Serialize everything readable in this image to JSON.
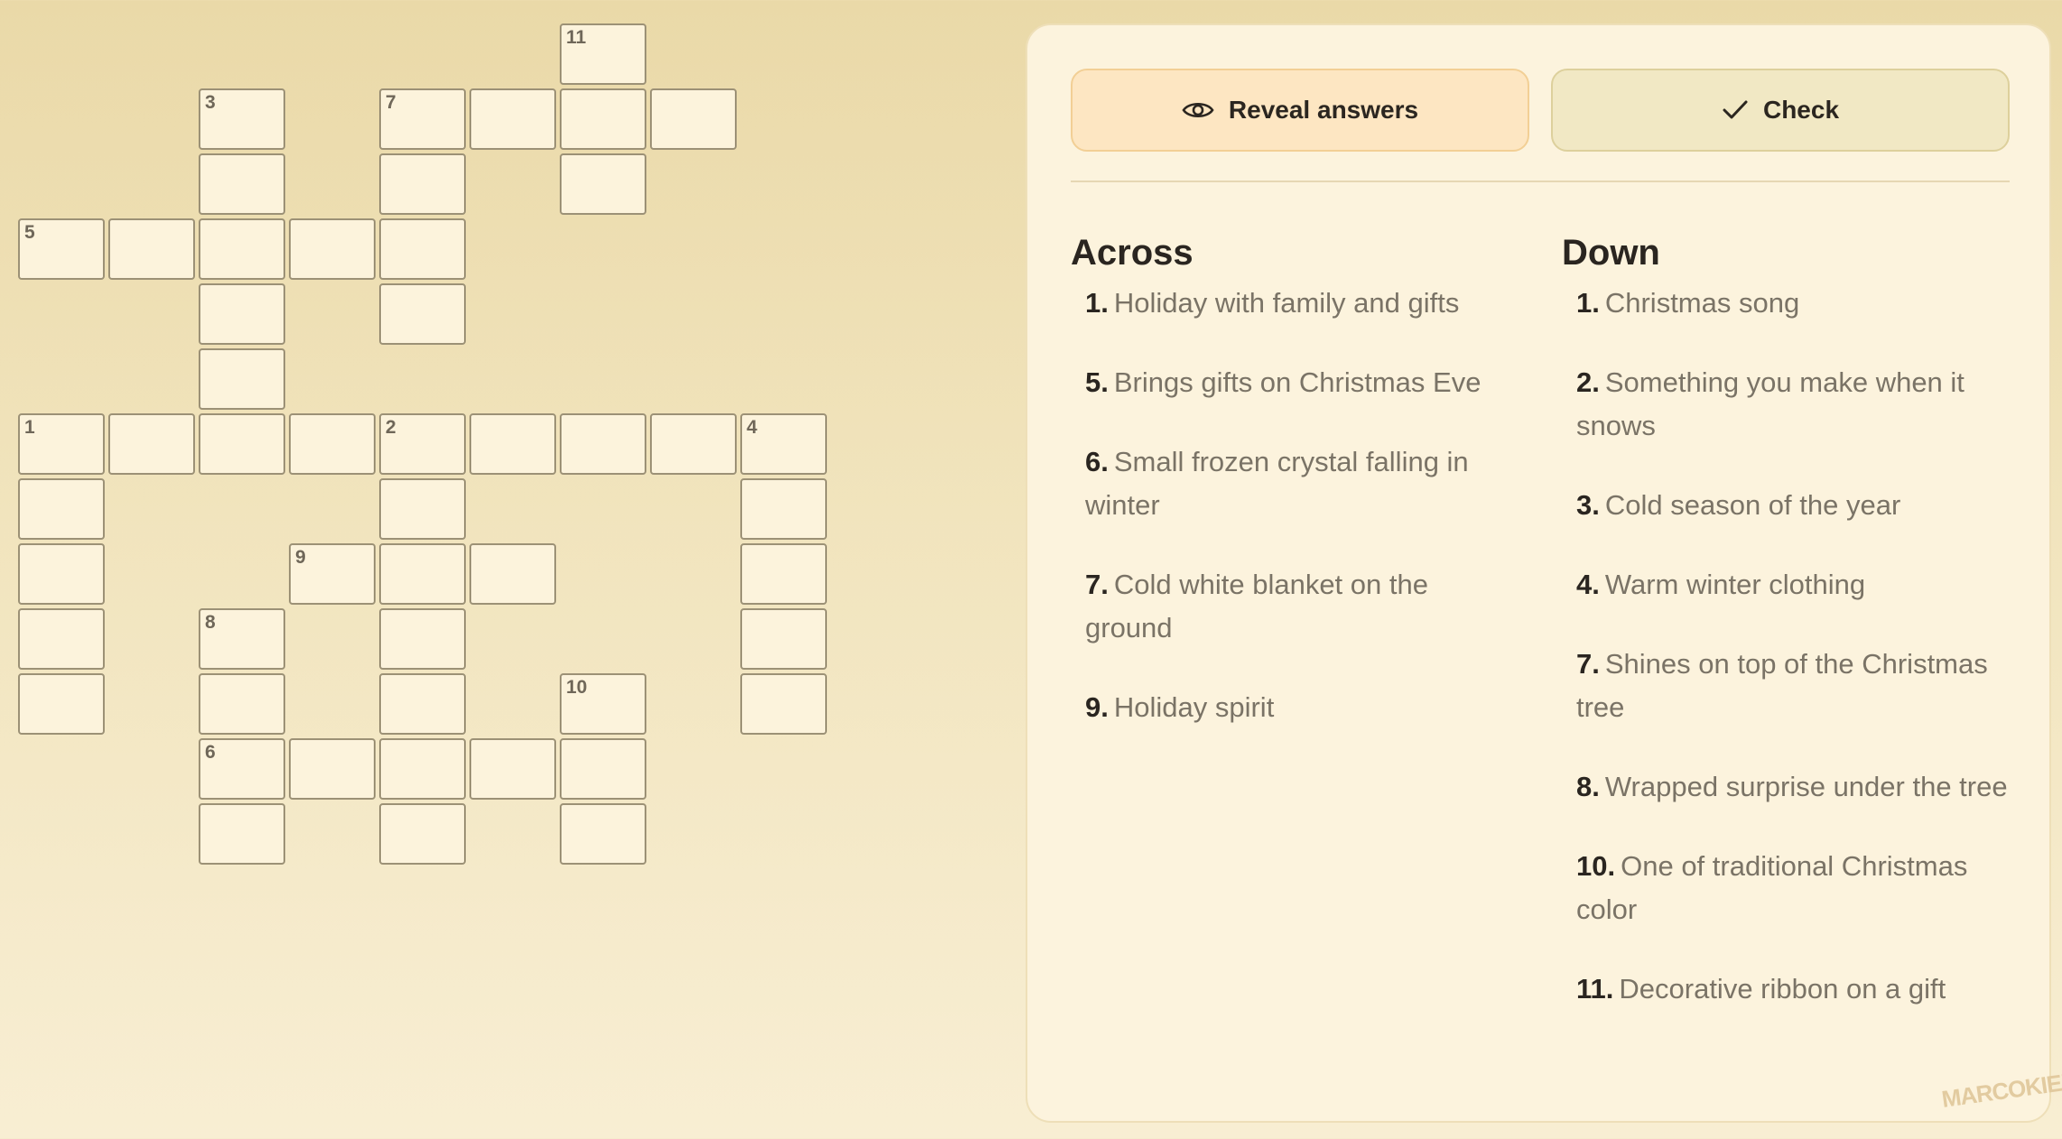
{
  "buttons": {
    "reveal_label": "Reveal answers",
    "check_label": "Check"
  },
  "clues": {
    "across_title": "Across",
    "down_title": "Down",
    "across": [
      {
        "num": "1.",
        "text": "Holiday with family and gifts"
      },
      {
        "num": "5.",
        "text": "Brings gifts on Christmas Eve"
      },
      {
        "num": "6.",
        "text": "Small frozen crystal falling in winter"
      },
      {
        "num": "7.",
        "text": "Cold white blanket on the ground"
      },
      {
        "num": "9.",
        "text": "Holiday spirit"
      }
    ],
    "down": [
      {
        "num": "1.",
        "text": "Christmas song"
      },
      {
        "num": "2.",
        "text": "Something you make when it snows"
      },
      {
        "num": "3.",
        "text": "Cold season of the year"
      },
      {
        "num": "4.",
        "text": "Warm winter clothing"
      },
      {
        "num": "7.",
        "text": "Shines on top of the Christmas tree"
      },
      {
        "num": "8.",
        "text": "Wrapped surprise under the tree"
      },
      {
        "num": "10.",
        "text": "One of traditional Christmas color"
      },
      {
        "num": "11.",
        "text": "Decorative ribbon on a gift"
      }
    ]
  },
  "grid": {
    "cells": [
      {
        "r": 0,
        "c": 6,
        "n": "11"
      },
      {
        "r": 1,
        "c": 2,
        "n": "3"
      },
      {
        "r": 1,
        "c": 4,
        "n": "7"
      },
      {
        "r": 1,
        "c": 5,
        "n": ""
      },
      {
        "r": 1,
        "c": 6,
        "n": ""
      },
      {
        "r": 1,
        "c": 7,
        "n": ""
      },
      {
        "r": 2,
        "c": 2,
        "n": ""
      },
      {
        "r": 2,
        "c": 4,
        "n": ""
      },
      {
        "r": 2,
        "c": 6,
        "n": ""
      },
      {
        "r": 3,
        "c": 0,
        "n": "5"
      },
      {
        "r": 3,
        "c": 1,
        "n": ""
      },
      {
        "r": 3,
        "c": 2,
        "n": ""
      },
      {
        "r": 3,
        "c": 3,
        "n": ""
      },
      {
        "r": 3,
        "c": 4,
        "n": ""
      },
      {
        "r": 4,
        "c": 2,
        "n": ""
      },
      {
        "r": 4,
        "c": 4,
        "n": ""
      },
      {
        "r": 5,
        "c": 2,
        "n": ""
      },
      {
        "r": 6,
        "c": 0,
        "n": "1"
      },
      {
        "r": 6,
        "c": 1,
        "n": ""
      },
      {
        "r": 6,
        "c": 2,
        "n": ""
      },
      {
        "r": 6,
        "c": 3,
        "n": ""
      },
      {
        "r": 6,
        "c": 4,
        "n": "2"
      },
      {
        "r": 6,
        "c": 5,
        "n": ""
      },
      {
        "r": 6,
        "c": 6,
        "n": ""
      },
      {
        "r": 6,
        "c": 7,
        "n": ""
      },
      {
        "r": 6,
        "c": 8,
        "n": "4"
      },
      {
        "r": 7,
        "c": 0,
        "n": ""
      },
      {
        "r": 7,
        "c": 4,
        "n": ""
      },
      {
        "r": 7,
        "c": 8,
        "n": ""
      },
      {
        "r": 8,
        "c": 0,
        "n": ""
      },
      {
        "r": 8,
        "c": 3,
        "n": "9"
      },
      {
        "r": 8,
        "c": 4,
        "n": ""
      },
      {
        "r": 8,
        "c": 5,
        "n": ""
      },
      {
        "r": 8,
        "c": 8,
        "n": ""
      },
      {
        "r": 9,
        "c": 0,
        "n": ""
      },
      {
        "r": 9,
        "c": 2,
        "n": "8"
      },
      {
        "r": 9,
        "c": 4,
        "n": ""
      },
      {
        "r": 9,
        "c": 8,
        "n": ""
      },
      {
        "r": 10,
        "c": 0,
        "n": ""
      },
      {
        "r": 10,
        "c": 2,
        "n": ""
      },
      {
        "r": 10,
        "c": 4,
        "n": ""
      },
      {
        "r": 10,
        "c": 6,
        "n": "10"
      },
      {
        "r": 10,
        "c": 8,
        "n": ""
      },
      {
        "r": 11,
        "c": 2,
        "n": "6"
      },
      {
        "r": 11,
        "c": 3,
        "n": ""
      },
      {
        "r": 11,
        "c": 4,
        "n": ""
      },
      {
        "r": 11,
        "c": 5,
        "n": ""
      },
      {
        "r": 11,
        "c": 6,
        "n": ""
      },
      {
        "r": 12,
        "c": 2,
        "n": ""
      },
      {
        "r": 12,
        "c": 4,
        "n": ""
      },
      {
        "r": 12,
        "c": 6,
        "n": ""
      }
    ]
  },
  "icons": {
    "reveal": "eye-icon",
    "check": "checkmark-icon"
  },
  "watermark": "MARCOKIEMAS"
}
